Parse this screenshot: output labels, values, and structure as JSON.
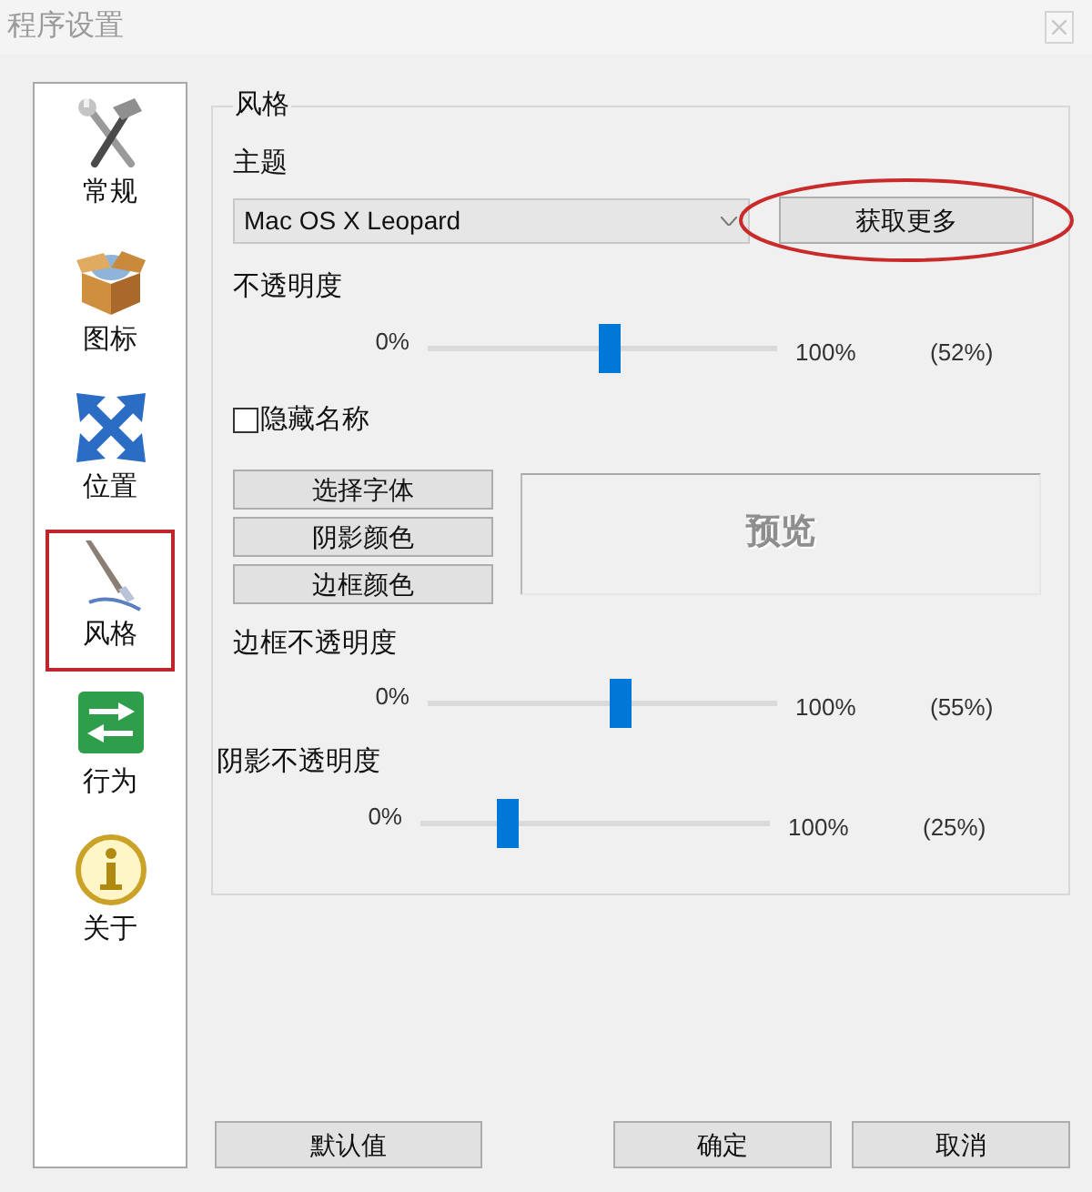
{
  "window": {
    "title": "程序设置"
  },
  "sidebar": {
    "items": [
      {
        "label": "常规",
        "selected": false
      },
      {
        "label": "图标",
        "selected": false
      },
      {
        "label": "位置",
        "selected": false
      },
      {
        "label": "风格",
        "selected": true
      },
      {
        "label": "行为",
        "selected": false
      },
      {
        "label": "关于",
        "selected": false
      }
    ]
  },
  "style_group": {
    "title": "风格",
    "theme_label": "主题",
    "theme_dropdown": {
      "value": "Mac OS X Leopard"
    },
    "get_more_button": {
      "label": "获取更多",
      "circled": true
    },
    "opacity": {
      "label": "不透明度",
      "min_label": "0%",
      "max_label": "100%",
      "reading": "(52%)",
      "level": 0.52
    },
    "hide_names": {
      "label": "隐藏名称",
      "checked": false
    },
    "buttons": [
      "选择字体",
      "阴影颜色",
      "边框颜色"
    ],
    "preview": {
      "text": "预览"
    },
    "border_opacity": {
      "label": "边框不透明度",
      "min_label": "0%",
      "max_label": "100%",
      "reading": "(55%)",
      "level": 0.55
    },
    "shadow_opacity": {
      "label": "阴影不透明度",
      "min_label": "0%",
      "max_label": "100%",
      "reading": "(25%)",
      "level": 0.25
    }
  },
  "footer": {
    "buttons": [
      "默认值",
      "确定",
      "取消"
    ]
  }
}
